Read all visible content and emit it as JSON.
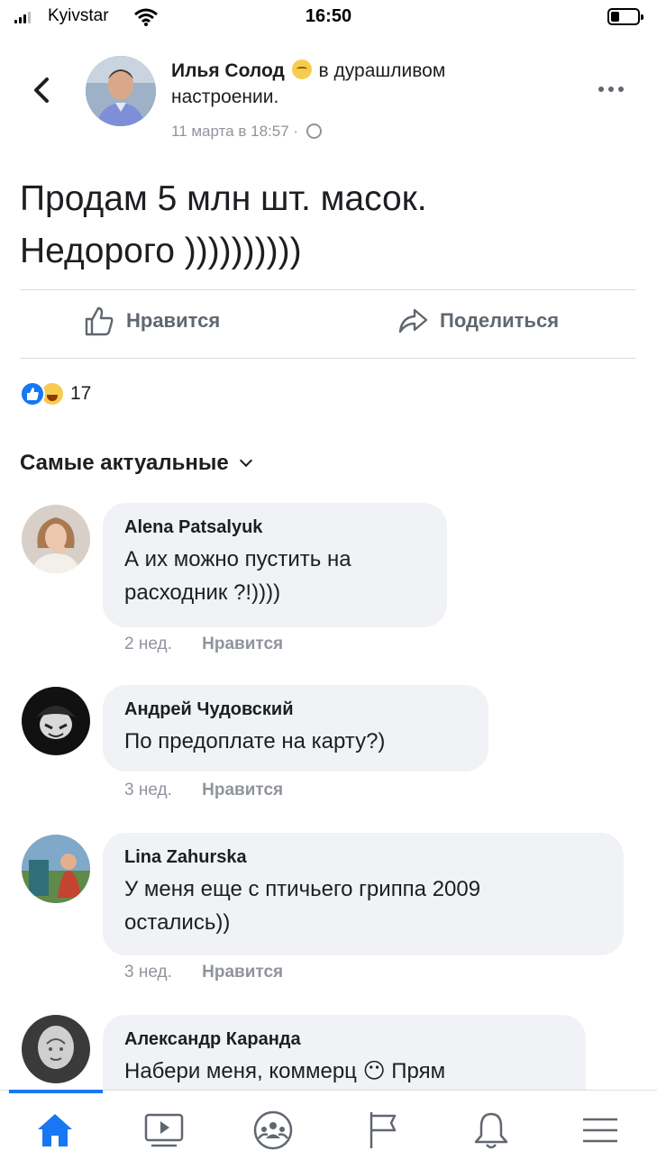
{
  "status_bar": {
    "carrier": "Kyivstar",
    "time": "16:50"
  },
  "post": {
    "author": "Илья Солод",
    "feeling": "в дурашливом настроении.",
    "timestamp": "11 марта в 18:57 ·",
    "text": "Продам 5 млн шт. масок.\nНедорого ))))))))))",
    "actions": {
      "like": "Нравится",
      "share": "Поделиться"
    },
    "reaction_count": "17"
  },
  "sort": {
    "label": "Самые актуальные"
  },
  "comments": [
    {
      "name": "Alena Patsalyuk",
      "text": "А их можно пустить на\nрасходник ?!))))",
      "time": "2 нед.",
      "like": "Нравится"
    },
    {
      "name": "Андрей Чудовский",
      "text": "По предоплате на карту?)",
      "time": "3 нед.",
      "like": "Нравится"
    },
    {
      "name": "Lina Zahurska",
      "text": "У меня еще с птичьего гриппа 2009\nостались))",
      "time": "3 нед.",
      "like": "Нравится"
    },
    {
      "name": "Александр Каранда",
      "text": "Набери меня, коммерц 😶 Прям"
    }
  ],
  "colors": {
    "accent": "#1877f2",
    "bubble": "#f0f2f5",
    "muted": "#90949c"
  },
  "icons": {
    "nav": [
      "home-icon",
      "video-icon",
      "groups-icon",
      "pages-flag-icon",
      "notifications-bell-icon",
      "menu-icon"
    ]
  }
}
